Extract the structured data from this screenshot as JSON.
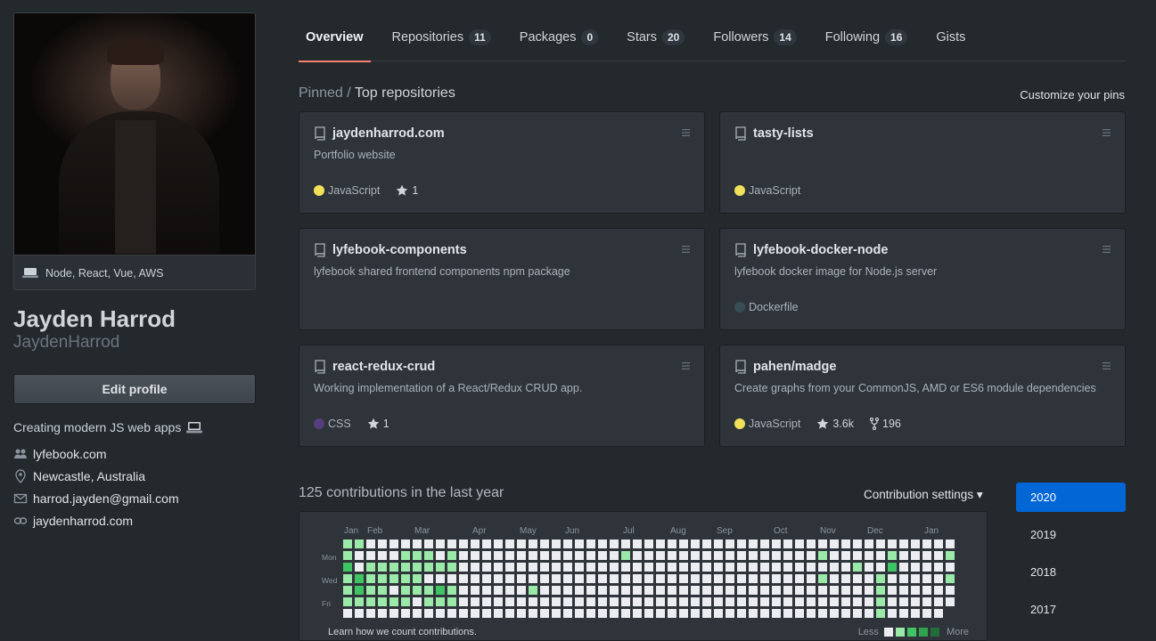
{
  "profile": {
    "status": "Node, React, Vue, AWS",
    "full_name": "Jayden Harrod",
    "username": "JaydenHarrod",
    "edit_label": "Edit profile",
    "bio": "Creating modern JS web apps",
    "vcard": [
      {
        "icon": "people-icon",
        "text": "lyfebook.com"
      },
      {
        "icon": "location-icon",
        "text": "Newcastle, Australia"
      },
      {
        "icon": "mail-icon",
        "text": "harrod.jayden@gmail.com"
      },
      {
        "icon": "link-icon",
        "text": "jaydenharrod.com"
      }
    ]
  },
  "tabs": [
    {
      "label": "Overview",
      "count": null
    },
    {
      "label": "Repositories",
      "count": "11"
    },
    {
      "label": "Packages",
      "count": "0"
    },
    {
      "label": "Stars",
      "count": "20"
    },
    {
      "label": "Followers",
      "count": "14"
    },
    {
      "label": "Following",
      "count": "16"
    },
    {
      "label": "Gists",
      "count": null
    }
  ],
  "pinned": {
    "title_prefix": "Pinned /",
    "title_main": "Top repositories",
    "customize_label": "Customize your pins",
    "repos": [
      {
        "name": "jaydenharrod.com",
        "description": "Portfolio website",
        "language": "JavaScript",
        "lang_color": "#f1e05a",
        "stars": "1",
        "forks": null
      },
      {
        "name": "tasty-lists",
        "description": "",
        "language": "JavaScript",
        "lang_color": "#f1e05a",
        "stars": null,
        "forks": null
      },
      {
        "name": "lyfebook-components",
        "description": "lyfebook shared frontend components npm package",
        "language": null,
        "lang_color": null,
        "stars": null,
        "forks": null
      },
      {
        "name": "lyfebook-docker-node",
        "description": "lyfebook docker image for Node.js server",
        "language": "Dockerfile",
        "lang_color": "#384d54",
        "stars": null,
        "forks": null
      },
      {
        "name": "react-redux-crud",
        "description": "Working implementation of a React/Redux CRUD app.",
        "language": "CSS",
        "lang_color": "#563d7c",
        "stars": "1",
        "forks": null
      },
      {
        "name": "pahen/madge",
        "description": "Create graphs from your CommonJS, AMD or ES6 module dependencies",
        "language": "JavaScript",
        "lang_color": "#f1e05a",
        "stars": "3.6k",
        "forks": "196"
      }
    ]
  },
  "contributions": {
    "title": "125 contributions in the last year",
    "settings_label": "Contribution settings ▾",
    "months": [
      "Jan",
      "Feb",
      "Mar",
      "Apr",
      "May",
      "Jun",
      "Jul",
      "Aug",
      "Sep",
      "Oct",
      "Nov",
      "Dec",
      "Jan"
    ],
    "days": [
      "Mon",
      "Wed",
      "Fri"
    ],
    "learn_label": "Learn how we count contributions.",
    "legend_less": "Less",
    "legend_more": "More",
    "colors": [
      "#ebedf0",
      "#9be9a8",
      "#40c463",
      "#30a14e",
      "#216e39"
    ]
  },
  "years": [
    "2020",
    "2019",
    "2018",
    "2017"
  ],
  "selected_year": "2020"
}
